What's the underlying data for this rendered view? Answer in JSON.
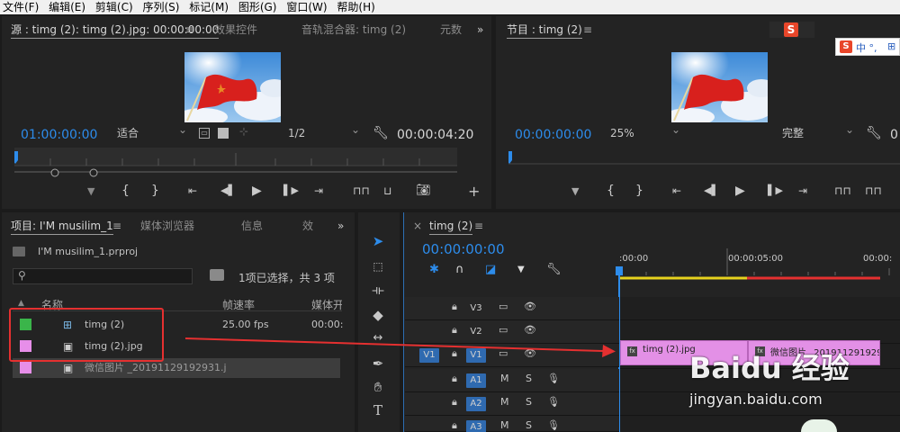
{
  "menubar": {
    "items": [
      "文件(F)",
      "编辑(E)",
      "剪辑(C)",
      "序列(S)",
      "标记(M)",
      "图形(G)",
      "窗口(W)",
      "帮助(H)"
    ]
  },
  "source_panel": {
    "tab_source": "源 : timg (2): timg (2).jpg: 00:00:00:00",
    "tab_effects": "效果控件",
    "tab_mixer": "音轨混合器: timg (2)",
    "tab_meta": "元数",
    "timecode_current": "01:00:00:00",
    "fit_label": "适合",
    "resolution": "1/2",
    "timecode_duration": "00:00:04:20"
  },
  "program_panel": {
    "tab_program": "节目 : timg (2)",
    "timecode_current": "00:00:00:00",
    "zoom": "25%",
    "quality": "完整",
    "timecode_partial": "0"
  },
  "ime": {
    "label": "中 °, ",
    "logo": "S"
  },
  "project_panel": {
    "tab_project": "项目: I'M musilim_1",
    "tab_media": "媒体浏览器",
    "tab_info": "信息",
    "tab_effects": "效",
    "project_file": "I'M musilim_1.prproj",
    "selection_info": "1项已选择，共 3 项",
    "columns": {
      "name": "名称",
      "fps": "帧速率",
      "media": "媒体开"
    },
    "items": [
      {
        "name": "timg (2)",
        "fps": "25.00 fps",
        "media": "00:00:",
        "color": "#3ab54a"
      },
      {
        "name": "timg (2).jpg",
        "fps": "",
        "media": "",
        "color": "#e78ee9"
      },
      {
        "name": "微信图片 _20191129192931.j",
        "fps": "",
        "media": "",
        "color": "#e78ee9"
      }
    ]
  },
  "timeline_panel": {
    "tab_label": "timg (2)",
    "timecode": "00:00:00:00",
    "ruler_labels": [
      ":00:00",
      "00:00:05:00",
      "00:00:"
    ],
    "tracks": [
      {
        "name": "V3",
        "kind": "video"
      },
      {
        "name": "V2",
        "kind": "video"
      },
      {
        "name": "V1",
        "kind": "video",
        "source": "V1"
      },
      {
        "name": "A1",
        "kind": "audio"
      },
      {
        "name": "A2",
        "kind": "audio"
      },
      {
        "name": "A3",
        "kind": "audio"
      }
    ],
    "clip1_label": "timg (2).jpg",
    "clip2_label": "微信图片 _20191129192931.p",
    "audio_m": "M",
    "audio_s": "S"
  },
  "watermark": {
    "brand": "Baidu 经验",
    "url": "jingyan.baidu.com"
  },
  "colors": {
    "accent_blue": "#2d8ceb",
    "clip_pink": "#e390e6",
    "highlight_red": "#e53030",
    "ruler_yellow": "#e6d21e"
  }
}
